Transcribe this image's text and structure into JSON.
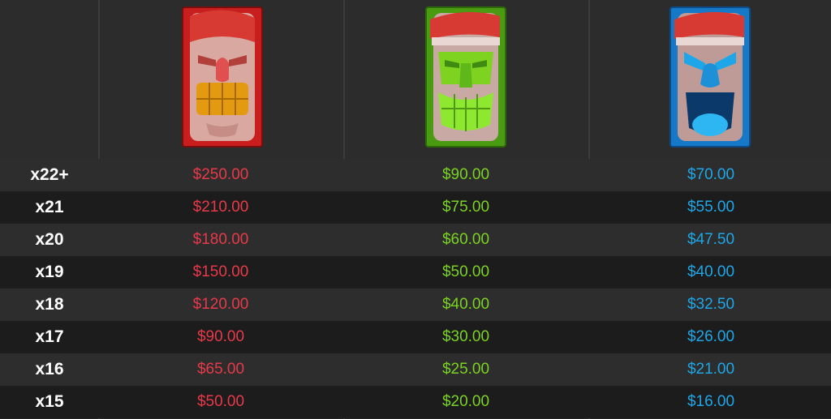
{
  "colors": {
    "red": "#e8394a",
    "green": "#7bd21f",
    "blue": "#1ea7e8"
  },
  "symbols": [
    {
      "icon": "red-tiki-mask-icon"
    },
    {
      "icon": "green-tiki-mask-icon"
    },
    {
      "icon": "blue-tiki-mask-icon"
    }
  ],
  "rows": [
    {
      "mult": "x22+",
      "red": "$250.00",
      "green": "$90.00",
      "blue": "$70.00"
    },
    {
      "mult": "x21",
      "red": "$210.00",
      "green": "$75.00",
      "blue": "$55.00"
    },
    {
      "mult": "x20",
      "red": "$180.00",
      "green": "$60.00",
      "blue": "$47.50"
    },
    {
      "mult": "x19",
      "red": "$150.00",
      "green": "$50.00",
      "blue": "$40.00"
    },
    {
      "mult": "x18",
      "red": "$120.00",
      "green": "$40.00",
      "blue": "$32.50"
    },
    {
      "mult": "x17",
      "red": "$90.00",
      "green": "$30.00",
      "blue": "$26.00"
    },
    {
      "mult": "x16",
      "red": "$65.00",
      "green": "$25.00",
      "blue": "$21.00"
    },
    {
      "mult": "x15",
      "red": "$50.00",
      "green": "$20.00",
      "blue": "$16.00"
    }
  ]
}
